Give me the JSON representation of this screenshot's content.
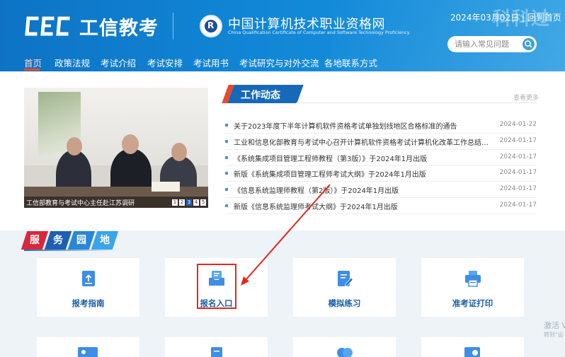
{
  "header": {
    "logo_text": "工信教考",
    "site_name_cn": "中国计算机技术职业资格网",
    "site_name_en": "China Qualification Certificate of Computer and Software Technology Proficiency",
    "date": "2024年03月02日 | 回到首页",
    "watermark": "科科过",
    "search_placeholder": "请输入常见问题"
  },
  "nav": [
    "首页",
    "政策法规",
    "考试介绍",
    "考试安排",
    "考试用书",
    "考试研究与对外交流",
    "各地联系方式"
  ],
  "slideshow": {
    "caption": "工信部教育与考试中心主任赴江苏调研",
    "pages": [
      "1",
      "2",
      "3",
      "4",
      "5"
    ],
    "active_page": 3
  },
  "news": {
    "title": "工作动态",
    "more": "查看更多",
    "items": [
      {
        "title": "关于2023年度下半年计算机软件资格考试单独划线地区合格标准的通告",
        "date": "2024-01-22"
      },
      {
        "title": "工业和信息化部教育与考试中心召开计算机软件资格考试计算机化改革工作总结座...",
        "date": "2024-01-17"
      },
      {
        "title": "《系统集成项目管理工程师教程（第3版）》于2024年1月出版",
        "date": "2024-01-17"
      },
      {
        "title": "新版《系统集成项目管理工程师考试大纲》于2024年1月出版",
        "date": "2024-01-17"
      },
      {
        "title": "《信息系统监理师教程（第2版）》于2024年1月出版",
        "date": "2024-01-17"
      },
      {
        "title": "新版《信息系统监理师考试大纲》于2024年1月出版",
        "date": "2024-01-17"
      }
    ]
  },
  "services": {
    "title_chars": [
      "服",
      "务",
      "园",
      "地"
    ],
    "cards": [
      {
        "label": "报考指南",
        "icon": "upload-doc-icon"
      },
      {
        "label": "报名入口",
        "icon": "inbox-register-icon"
      },
      {
        "label": "模拟练习",
        "icon": "edit-doc-icon"
      },
      {
        "label": "准考证打印",
        "icon": "printer-icon"
      }
    ]
  },
  "overlay": {
    "activate_line1": "激活 V",
    "activate_line2": "转到\"设"
  },
  "colors": {
    "header_blue": "#1186d6",
    "nav_active": "#e84a2f",
    "card_label": "#1a5ea8",
    "icon_blue": "#3d8ee6",
    "highlight_red": "#e02a1e"
  }
}
